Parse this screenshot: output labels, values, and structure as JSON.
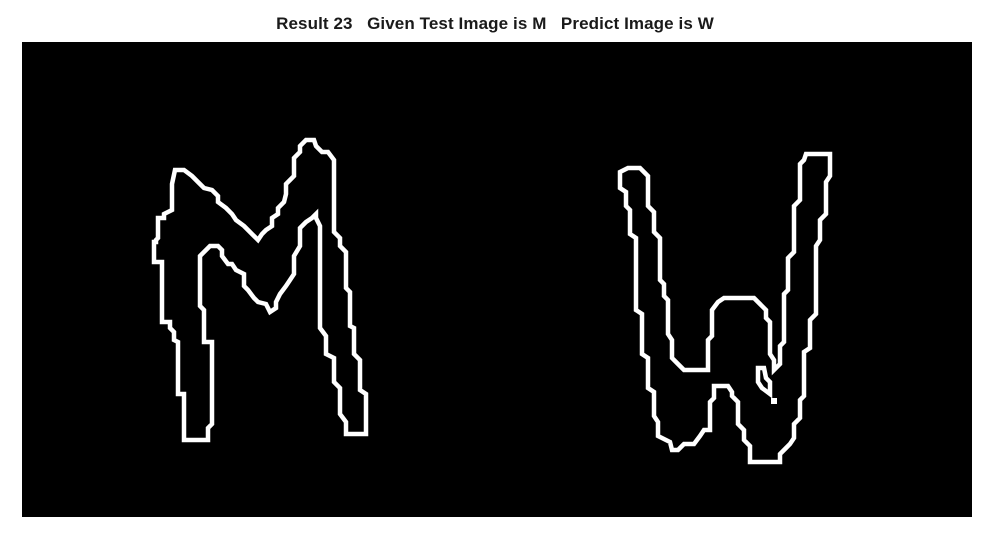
{
  "figure": {
    "title": "Result 23   Given Test Image is M   Predict Image is W"
  },
  "image": {
    "background_color": "#000000",
    "stroke_color": "#ffffff",
    "glyphs": [
      {
        "name": "test-glyph-m",
        "letter_shown": "M"
      },
      {
        "name": "predicted-glyph-w",
        "letter_shown": "W"
      }
    ]
  }
}
